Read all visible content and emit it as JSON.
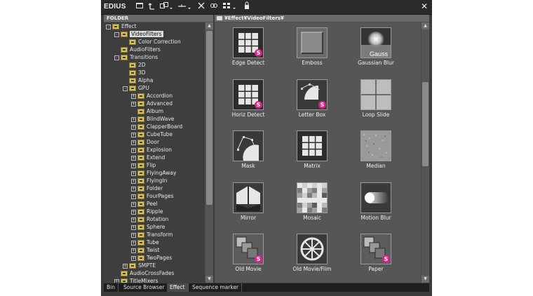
{
  "app": {
    "title": "EDIUS"
  },
  "left_panel": {
    "header": "FOLDER"
  },
  "right_panel": {
    "path": "¥Effect¥VideoFilters¥"
  },
  "tree": [
    {
      "label": "Effect",
      "level": 0,
      "expander": "-"
    },
    {
      "label": "VideoFilters",
      "level": 1,
      "expander": "-",
      "selected": true
    },
    {
      "label": "Color Correction",
      "level": 2,
      "expander": ""
    },
    {
      "label": "AudioFilters",
      "level": 1,
      "expander": ""
    },
    {
      "label": "Transitions",
      "level": 1,
      "expander": "-"
    },
    {
      "label": "2D",
      "level": 2,
      "expander": ""
    },
    {
      "label": "3D",
      "level": 2,
      "expander": ""
    },
    {
      "label": "Alpha",
      "level": 2,
      "expander": ""
    },
    {
      "label": "GPU",
      "level": 2,
      "expander": "-"
    },
    {
      "label": "Accordion",
      "level": 3,
      "expander": "+"
    },
    {
      "label": "Advanced",
      "level": 3,
      "expander": "+"
    },
    {
      "label": "Album",
      "level": 3,
      "expander": ""
    },
    {
      "label": "BlindWave",
      "level": 3,
      "expander": "+"
    },
    {
      "label": "ClapperBoard",
      "level": 3,
      "expander": "+"
    },
    {
      "label": "CubeTube",
      "level": 3,
      "expander": "+"
    },
    {
      "label": "Door",
      "level": 3,
      "expander": "+"
    },
    {
      "label": "Explosion",
      "level": 3,
      "expander": "+"
    },
    {
      "label": "Extend",
      "level": 3,
      "expander": "+"
    },
    {
      "label": "Flip",
      "level": 3,
      "expander": "+"
    },
    {
      "label": "FlyingAway",
      "level": 3,
      "expander": "+"
    },
    {
      "label": "FlyingIn",
      "level": 3,
      "expander": "+"
    },
    {
      "label": "Folder",
      "level": 3,
      "expander": "+"
    },
    {
      "label": "FourPages",
      "level": 3,
      "expander": "+"
    },
    {
      "label": "Peel",
      "level": 3,
      "expander": "+"
    },
    {
      "label": "Ripple",
      "level": 3,
      "expander": "+"
    },
    {
      "label": "Rotation",
      "level": 3,
      "expander": "+"
    },
    {
      "label": "Sphere",
      "level": 3,
      "expander": "+"
    },
    {
      "label": "Transform",
      "level": 3,
      "expander": "+"
    },
    {
      "label": "Tube",
      "level": 3,
      "expander": "+"
    },
    {
      "label": "Twist",
      "level": 3,
      "expander": "+"
    },
    {
      "label": "TwoPages",
      "level": 3,
      "expander": "+"
    },
    {
      "label": "SMPTE",
      "level": 2,
      "expander": "+"
    },
    {
      "label": "AudioCrossFades",
      "level": 1,
      "expander": ""
    },
    {
      "label": "TitleMixers",
      "level": 1,
      "expander": "+"
    }
  ],
  "effects": [
    {
      "label": "Edge Detect",
      "icon": "grid-icon",
      "badge": "S"
    },
    {
      "label": "Emboss",
      "icon": "emboss-icon",
      "badge": ""
    },
    {
      "label": "Gaussian Blur",
      "icon": "gaussian-blur-icon",
      "badge": "",
      "thumb_text": "Gauss"
    },
    {
      "label": "Horiz Detect",
      "icon": "grid-icon",
      "badge": "S"
    },
    {
      "label": "Letter Box",
      "icon": "letter-box-icon",
      "badge": "S"
    },
    {
      "label": "Loop Slide",
      "icon": "loop-slide-icon",
      "badge": ""
    },
    {
      "label": "Mask",
      "icon": "mask-icon",
      "badge": ""
    },
    {
      "label": "Matrix",
      "icon": "grid-icon",
      "badge": ""
    },
    {
      "label": "Median",
      "icon": "median-icon",
      "badge": ""
    },
    {
      "label": "Mirror",
      "icon": "mirror-icon",
      "badge": ""
    },
    {
      "label": "Mosaic",
      "icon": "mosaic-icon",
      "badge": ""
    },
    {
      "label": "Motion Blur",
      "icon": "motion-blur-icon",
      "badge": ""
    },
    {
      "label": "Old Movie",
      "icon": "old-movie-icon",
      "badge": "S"
    },
    {
      "label": "Old Movie/Film",
      "icon": "film-reel-icon",
      "badge": ""
    },
    {
      "label": "Paper",
      "icon": "paper-icon",
      "badge": "S"
    }
  ],
  "tabs": [
    {
      "label": "Bin",
      "active": false
    },
    {
      "label": "Source Browser",
      "active": false
    },
    {
      "label": "Effect",
      "active": true
    },
    {
      "label": "Sequence marker",
      "active": false
    }
  ],
  "toolbar": {
    "icons": [
      "new-folder-icon",
      "up-folder-icon",
      "layout-icon",
      "separator-icon",
      "delete-icon",
      "tools-icon",
      "view-icon",
      "lock-icon"
    ],
    "close_glyph": "✕"
  },
  "colors": {
    "badge": "#e0208a",
    "selection": "#dcdcdc"
  }
}
